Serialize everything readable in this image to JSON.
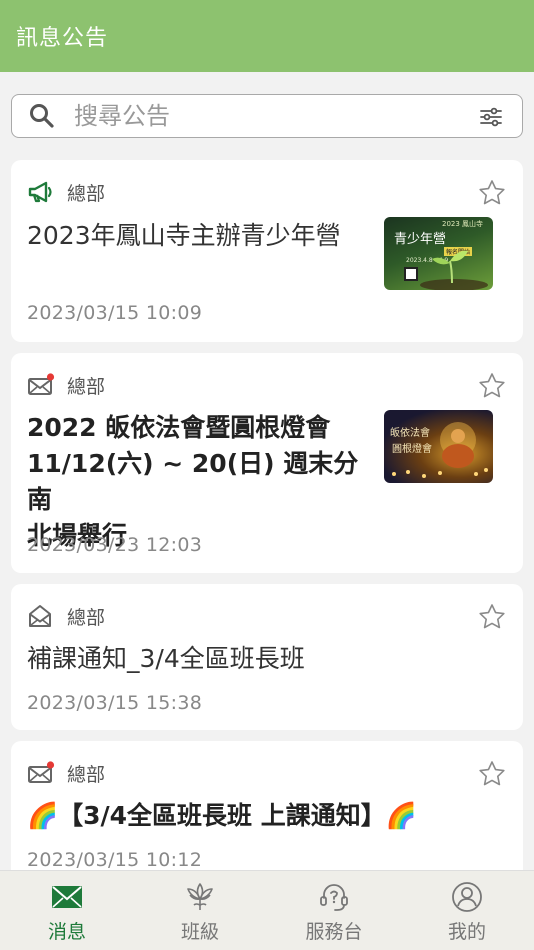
{
  "header": {
    "title": "訊息公告"
  },
  "search": {
    "placeholder": "搜尋公告",
    "value": ""
  },
  "announcements": [
    {
      "source": "總部",
      "icon": "megaphone-icon",
      "title": "2023年鳳山寺主辦青少年營",
      "date": "2023/03/15 10:09",
      "bold": false,
      "has_thumbnail": true,
      "thumbnail": {
        "badge": "2023 鳳山寺",
        "heading": "青少年營",
        "tag": "報名開始",
        "line": "2023.4.8 - 4.9"
      }
    },
    {
      "source": "總部",
      "icon": "unread-mail-icon",
      "title_lines": [
        "2022 皈依法會暨圓根燈會",
        "11/12(六) ~ 20(日) 週末分南",
        "北場舉行"
      ],
      "date": "2023/03/23 12:03",
      "bold": true,
      "has_thumbnail": true,
      "thumbnail": {
        "line1": "皈依法會",
        "line2": "圓根燈會"
      }
    },
    {
      "source": "總部",
      "icon": "opened-mail-icon",
      "title": "補課通知_3/4全區班長班",
      "date": "2023/03/15 15:38",
      "bold": false,
      "has_thumbnail": false
    },
    {
      "source": "總部",
      "icon": "unread-mail-icon",
      "title": "🌈【3/4全區班長班 上課通知】🌈",
      "date": "2023/03/15 10:12",
      "bold": true,
      "has_thumbnail": false
    }
  ],
  "tabs": [
    {
      "label": "消息",
      "icon": "mail-icon",
      "active": true
    },
    {
      "label": "班級",
      "icon": "lotus-icon",
      "active": false
    },
    {
      "label": "服務台",
      "icon": "headset-icon",
      "active": false
    },
    {
      "label": "我的",
      "icon": "profile-icon",
      "active": false
    }
  ],
  "colors": {
    "header": "#8dc26f",
    "accent": "#1e7a3a",
    "unread_dot": "#e53935"
  }
}
